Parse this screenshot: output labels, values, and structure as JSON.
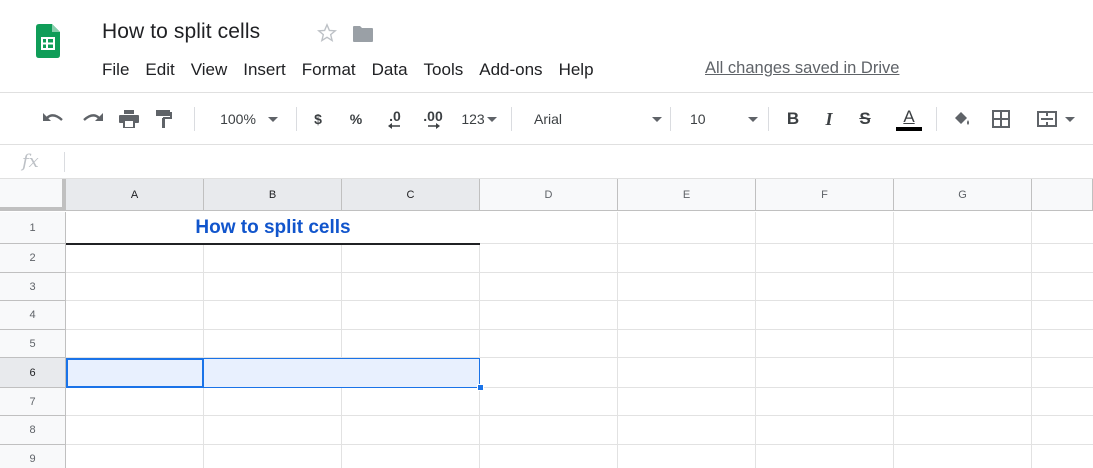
{
  "document": {
    "title": "How to split cells",
    "save_status": "All changes saved in Drive"
  },
  "menu": [
    {
      "label": "File"
    },
    {
      "label": "Edit"
    },
    {
      "label": "View"
    },
    {
      "label": "Insert"
    },
    {
      "label": "Format"
    },
    {
      "label": "Data"
    },
    {
      "label": "Tools"
    },
    {
      "label": "Add-ons"
    },
    {
      "label": "Help"
    }
  ],
  "toolbar": {
    "zoom": "100%",
    "currency_label": "$",
    "percent_label": "%",
    "decrease_decimal_label": ".0",
    "increase_decimal_label": ".00",
    "more_formats_label": "123",
    "font_family": "Arial",
    "font_size": "10",
    "bold_label": "B",
    "italic_label": "I",
    "strikethrough_label": "S",
    "text_color_label": "A"
  },
  "formula_bar": {
    "fx_label": "fx",
    "value": ""
  },
  "sheet": {
    "columns": [
      {
        "label": "A"
      },
      {
        "label": "B"
      },
      {
        "label": "C"
      },
      {
        "label": "D"
      },
      {
        "label": "E"
      },
      {
        "label": "F"
      },
      {
        "label": "G"
      }
    ],
    "rows": [
      {
        "label": "1"
      },
      {
        "label": "2"
      },
      {
        "label": "3"
      },
      {
        "label": "4"
      },
      {
        "label": "5"
      },
      {
        "label": "6"
      },
      {
        "label": "7"
      },
      {
        "label": "8"
      },
      {
        "label": "9"
      }
    ],
    "merged_cell_text": "How to split cells",
    "merged_cell_range": "A1:C1",
    "selected_range": "A6:C6",
    "active_cell": "A6"
  },
  "colors": {
    "brand_green": "#0f9d58",
    "selection_blue": "#1a73e8",
    "title_text_blue": "#1155cc"
  }
}
